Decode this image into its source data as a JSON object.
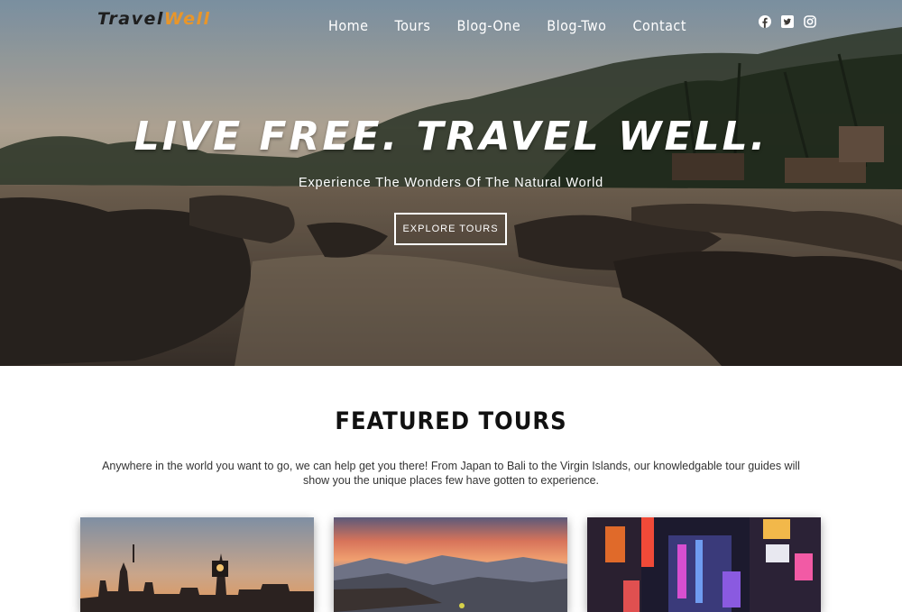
{
  "header": {
    "logo": {
      "part1": "Travel",
      "part2": "Well"
    },
    "nav": [
      "Home",
      "Tours",
      "Blog-One",
      "Blog-Two",
      "Contact"
    ],
    "social_icons": [
      "facebook-icon",
      "twitter-icon",
      "instagram-icon"
    ]
  },
  "hero": {
    "title": "LIVE FREE. TRAVEL WELL.",
    "subtitle": "Experience The Wonders Of The Natural World",
    "button": "EXPLORE TOURS"
  },
  "featured": {
    "title": "FEATURED TOURS",
    "description": "Anywhere in the world you want to go, we can help get you there! From Japan to Bali to the Virgin Islands, our knowledgable tour guides will show you the unique places few have gotten to experience."
  },
  "colors": {
    "logo_accent": "#e8962a",
    "logo_dark": "#1e1e1e",
    "white": "#ffffff",
    "heading": "#111111"
  }
}
